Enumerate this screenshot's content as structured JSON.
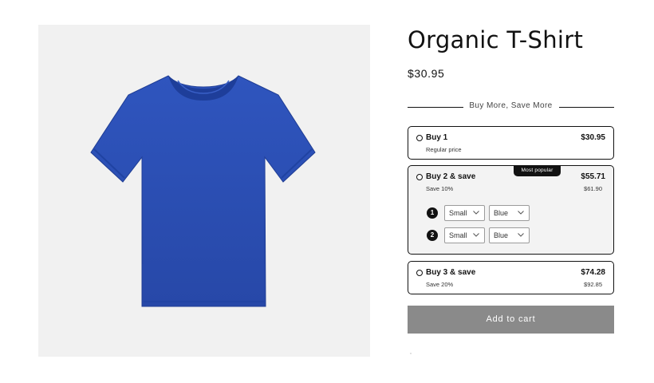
{
  "product": {
    "title": "Organic T-Shirt",
    "price": "$30.95",
    "image_color": "#2a4fb5",
    "image_name": "blue-tshirt"
  },
  "bundle": {
    "heading": "Buy More, Save More",
    "offers": [
      {
        "title": "Buy 1",
        "subtitle": "Regular price",
        "price": "$30.95",
        "compare_price": "",
        "selected": false
      },
      {
        "title": "Buy 2 & save",
        "subtitle": "Save 10%",
        "price": "$55.71",
        "compare_price": "$61.90",
        "badge": "Most popular",
        "selected": true,
        "variants": [
          {
            "number": "1",
            "size": "Small",
            "color": "Blue"
          },
          {
            "number": "2",
            "size": "Small",
            "color": "Blue"
          }
        ]
      },
      {
        "title": "Buy 3 & save",
        "subtitle": "Save 20%",
        "price": "$74.28",
        "compare_price": "$92.85",
        "selected": false
      }
    ]
  },
  "cart": {
    "button_label": "Add to cart",
    "button_color": "#8a8a8a"
  },
  "colors": {
    "text": "#121212",
    "panel_bg": "#f1f1f1",
    "selected_bg": "#f3f3f3"
  }
}
